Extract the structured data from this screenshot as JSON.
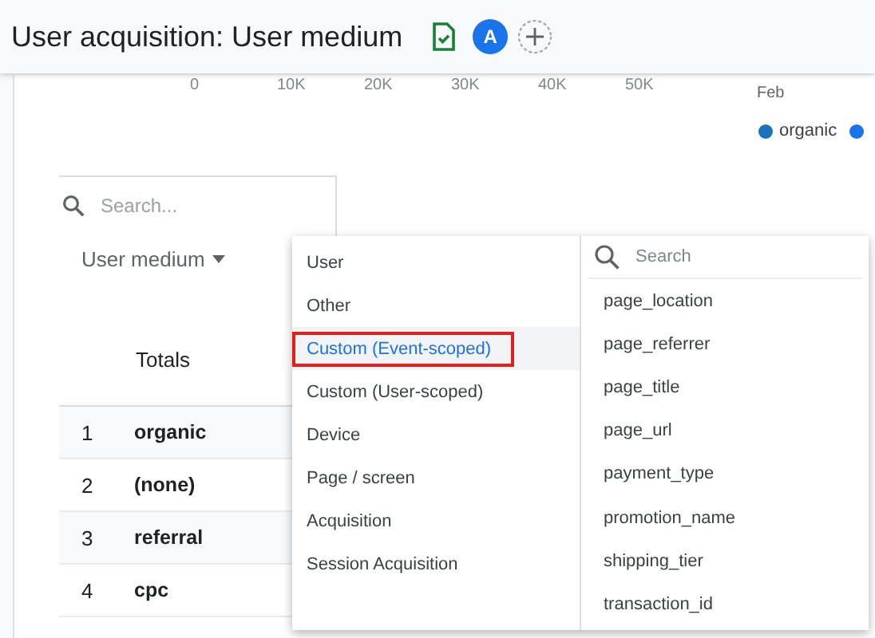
{
  "header": {
    "title": "User acquisition: User medium",
    "avatar": "A"
  },
  "chart": {
    "axis_ticks": [
      "0",
      "10K",
      "20K",
      "30K",
      "40K",
      "50K"
    ],
    "date_label": "Feb",
    "legend": [
      {
        "label": "organic",
        "color": "#1a73b8"
      },
      {
        "color": "#1a73e8"
      }
    ]
  },
  "table": {
    "search": {
      "placeholder": "Search..."
    },
    "dimension": "User medium",
    "totals_label": "Totals",
    "rows": [
      {
        "rank": "1",
        "medium": "organic"
      },
      {
        "rank": "2",
        "medium": "(none)"
      },
      {
        "rank": "3",
        "medium": "referral"
      },
      {
        "rank": "4",
        "medium": "cpc"
      }
    ]
  },
  "menu": {
    "categories": [
      {
        "label": "User",
        "selected": false
      },
      {
        "label": "Other",
        "selected": false
      },
      {
        "label": "Custom (Event-scoped)",
        "selected": true
      },
      {
        "label": "Custom (User-scoped)",
        "selected": false
      },
      {
        "label": "Device",
        "selected": false
      },
      {
        "label": "Page / screen",
        "selected": false
      },
      {
        "label": "Acquisition",
        "selected": false
      },
      {
        "label": "Session Acquisition",
        "selected": false
      }
    ],
    "search": {
      "placeholder": "Search"
    },
    "options": [
      "page_location",
      "page_referrer",
      "page_title",
      "page_url",
      "payment_type",
      "promotion_name",
      "shipping_tier",
      "transaction_id"
    ]
  }
}
